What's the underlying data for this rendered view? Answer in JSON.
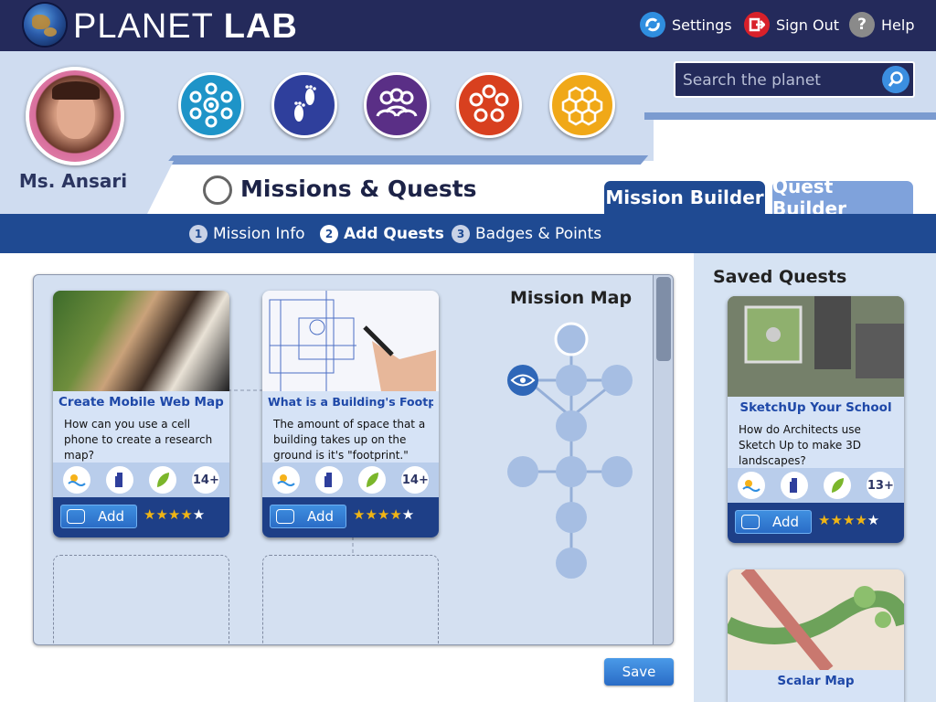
{
  "app": {
    "brand_light": "PLANET ",
    "brand_bold": "LAB"
  },
  "topnav": {
    "settings": "Settings",
    "signout": "Sign Out",
    "help": "Help",
    "help_glyph": "?"
  },
  "user": {
    "name": "Ms. Ansari"
  },
  "categories": [
    {
      "icon": "eye-network-icon",
      "color": "#1e94c8"
    },
    {
      "icon": "footprints-icon",
      "color": "#2f3f9c"
    },
    {
      "icon": "group-icon",
      "color": "#5a2f86"
    },
    {
      "icon": "flower-icon",
      "color": "#d8401f"
    },
    {
      "icon": "hexagon-honeycomb-icon",
      "color": "#f0a818"
    }
  ],
  "search": {
    "placeholder": "Search the planet"
  },
  "page": {
    "title": "Missions & Quests"
  },
  "tabs": {
    "active": "Mission Builder",
    "inactive": "Quest Builder"
  },
  "steps": [
    {
      "num": "1",
      "label": "Mission Info"
    },
    {
      "num": "2",
      "label": "Add Quests"
    },
    {
      "num": "3",
      "label": "Badges & Points"
    }
  ],
  "workspace": {
    "map_title": "Mission Map"
  },
  "cards": [
    {
      "title": "Create Mobile Web Maps",
      "desc": "How can you use a cell phone to create a research map?",
      "age": "14+",
      "add": "Add",
      "rating": 4
    },
    {
      "title": "What is a Building's Footprint?",
      "desc": "The amount of space that a building takes up on the ground is it's \"footprint.\"",
      "age": "14+",
      "add": "Add",
      "rating": 4
    }
  ],
  "saved": {
    "title": "Saved Quests",
    "cards": [
      {
        "title": "SketchUp Your School",
        "desc": "How do Architects use Sketch Up to make 3D landscapes?",
        "age": "13+",
        "add": "Add",
        "rating": 4
      },
      {
        "title": "Scalar Map"
      }
    ]
  },
  "actions": {
    "save": "Save"
  },
  "colors": {
    "navy": "#242a5b",
    "step_bar": "#1f4a92",
    "panel": "#cfdcf0",
    "accent_blue": "#2a6cc6",
    "star": "#f0b515"
  }
}
